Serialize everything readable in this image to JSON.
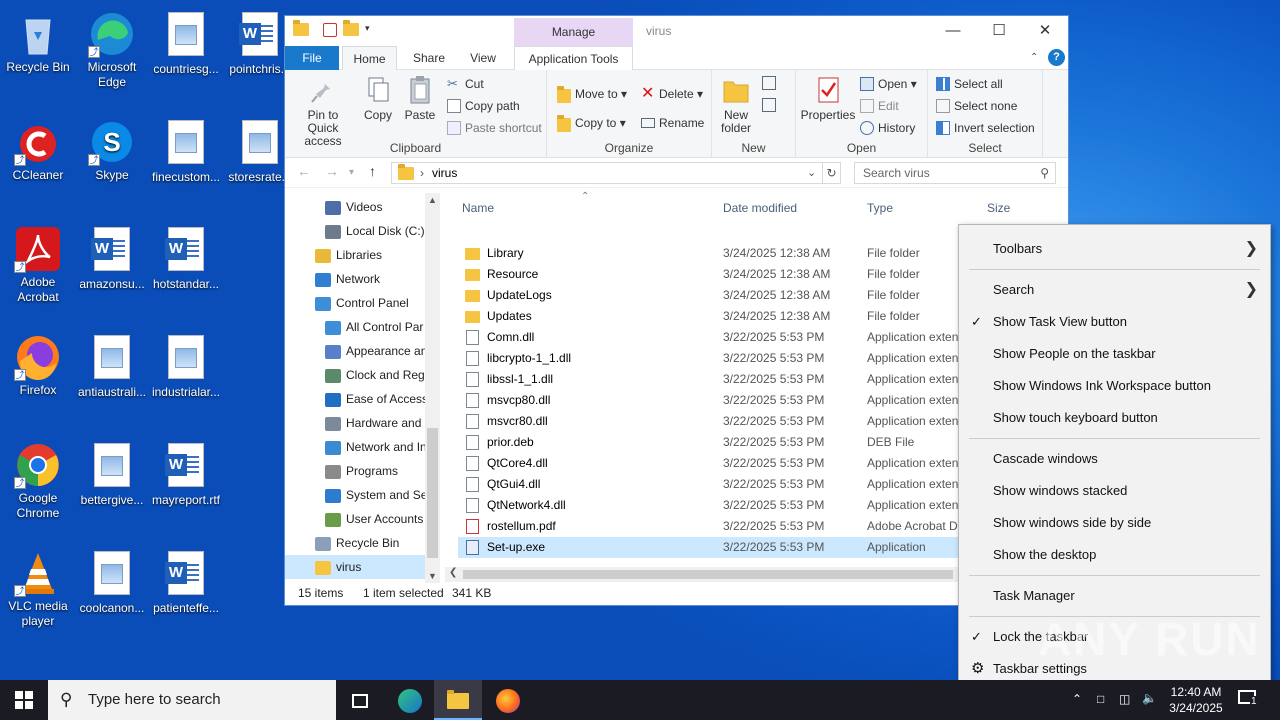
{
  "desktop": {
    "icons": [
      {
        "label": "Recycle Bin"
      },
      {
        "label": "Microsoft Edge"
      },
      {
        "label": "countriesg..."
      },
      {
        "label": "pointchris..."
      },
      {
        "label": "CCleaner"
      },
      {
        "label": "Skype"
      },
      {
        "label": "finecustom..."
      },
      {
        "label": "storesrate..."
      },
      {
        "label": "Adobe Acrobat"
      },
      {
        "label": "amazonsu..."
      },
      {
        "label": "hotstandar..."
      },
      {
        "label": "Firefox"
      },
      {
        "label": "antiaustrali..."
      },
      {
        "label": "industrialar..."
      },
      {
        "label": "Google Chrome"
      },
      {
        "label": "bettergive..."
      },
      {
        "label": "mayreport.rtf"
      },
      {
        "label": "VLC media player"
      },
      {
        "label": "coolcanon..."
      },
      {
        "label": "patienteffe..."
      }
    ]
  },
  "explorer": {
    "title": "virus",
    "manage_label": "Manage",
    "tabs": {
      "file": "File",
      "home": "Home",
      "share": "Share",
      "view": "View",
      "app_tools": "Application Tools"
    },
    "ribbon": {
      "clipboard": {
        "pin": "Pin to Quick access",
        "copy": "Copy",
        "paste": "Paste",
        "cut": "Cut",
        "copy_path": "Copy path",
        "paste_shortcut": "Paste shortcut",
        "label": "Clipboard"
      },
      "organize": {
        "move_to": "Move to ▾",
        "copy_to": "Copy to ▾",
        "delete": "Delete ▾",
        "rename": "Rename",
        "label": "Organize"
      },
      "new": {
        "new_folder": "New folder",
        "label": "New"
      },
      "open": {
        "properties": "Properties",
        "open": "Open ▾",
        "edit": "Edit",
        "history": "History",
        "label": "Open"
      },
      "select": {
        "select_all": "Select all",
        "select_none": "Select none",
        "invert": "Invert selection",
        "label": "Select"
      }
    },
    "address": {
      "path": "virus",
      "search_placeholder": "Search virus"
    },
    "nav": [
      {
        "label": "Videos",
        "color": "#4f6ea8"
      },
      {
        "label": "Local Disk (C:)",
        "color": "#6d7b8c"
      },
      {
        "label": "Libraries",
        "color": "#e8b93a"
      },
      {
        "label": "Network",
        "color": "#2f7fd3"
      },
      {
        "label": "Control Panel",
        "color": "#3c8ed8"
      },
      {
        "label": "All Control Par",
        "color": "#3c8ed8"
      },
      {
        "label": "Appearance an",
        "color": "#5a7fc9"
      },
      {
        "label": "Clock and Regi",
        "color": "#5a8a6a"
      },
      {
        "label": "Ease of Access",
        "color": "#1f6fc5"
      },
      {
        "label": "Hardware and",
        "color": "#7d8a99"
      },
      {
        "label": "Network and In",
        "color": "#3b8ad4"
      },
      {
        "label": "Programs",
        "color": "#8a8a8a"
      },
      {
        "label": "System and Se",
        "color": "#2e7bd0"
      },
      {
        "label": "User Accounts",
        "color": "#6b9c4a"
      },
      {
        "label": "Recycle Bin",
        "color": "#8aa0b8"
      },
      {
        "label": "virus",
        "color": "#f5c542"
      }
    ],
    "columns": {
      "name": "Name",
      "date": "Date modified",
      "type": "Type",
      "size": "Size"
    },
    "files": [
      {
        "name": "Library",
        "date": "3/24/2025 12:38 AM",
        "type": "File folder",
        "kind": "fd"
      },
      {
        "name": "Resource",
        "date": "3/24/2025 12:38 AM",
        "type": "File folder",
        "kind": "fd"
      },
      {
        "name": "UpdateLogs",
        "date": "3/24/2025 12:38 AM",
        "type": "File folder",
        "kind": "fd"
      },
      {
        "name": "Updates",
        "date": "3/24/2025 12:38 AM",
        "type": "File folder",
        "kind": "fd"
      },
      {
        "name": "Comn.dll",
        "date": "3/22/2025 5:53 PM",
        "type": "Application exten",
        "kind": "dl"
      },
      {
        "name": "libcrypto-1_1.dll",
        "date": "3/22/2025 5:53 PM",
        "type": "Application exten",
        "kind": "dl"
      },
      {
        "name": "libssl-1_1.dll",
        "date": "3/22/2025 5:53 PM",
        "type": "Application exten",
        "kind": "dl"
      },
      {
        "name": "msvcp80.dll",
        "date": "3/22/2025 5:53 PM",
        "type": "Application exten",
        "kind": "dl"
      },
      {
        "name": "msvcr80.dll",
        "date": "3/22/2025 5:53 PM",
        "type": "Application exten",
        "kind": "dl"
      },
      {
        "name": "prior.deb",
        "date": "3/22/2025 5:53 PM",
        "type": "DEB File",
        "kind": "dl"
      },
      {
        "name": "QtCore4.dll",
        "date": "3/22/2025 5:53 PM",
        "type": "Application exten",
        "kind": "dl"
      },
      {
        "name": "QtGui4.dll",
        "date": "3/22/2025 5:53 PM",
        "type": "Application exten",
        "kind": "dl"
      },
      {
        "name": "QtNetwork4.dll",
        "date": "3/22/2025 5:53 PM",
        "type": "Application exten",
        "kind": "dl"
      },
      {
        "name": "rostellum.pdf",
        "date": "3/22/2025 5:53 PM",
        "type": "Adobe Acrobat D",
        "kind": "pdf"
      },
      {
        "name": "Set-up.exe",
        "date": "3/22/2025 5:53 PM",
        "type": "Application",
        "kind": "exe"
      }
    ],
    "status": {
      "items": "15 items",
      "selected": "1 item selected",
      "size": "341 KB"
    }
  },
  "context_menu": {
    "toolbars": "Toolbars",
    "search": "Search",
    "task_view": "Show Task View button",
    "people": "Show People on the taskbar",
    "ink": "Show Windows Ink Workspace button",
    "touch_kb": "Show touch keyboard button",
    "cascade": "Cascade windows",
    "stacked": "Show windows stacked",
    "side_by_side": "Show windows side by side",
    "desktop": "Show the desktop",
    "task_manager": "Task Manager",
    "lock": "Lock the taskbar",
    "settings": "Taskbar settings"
  },
  "watermark": "ANY RUN",
  "taskbar": {
    "search_placeholder": "Type here to search",
    "time": "12:40 AM",
    "date": "3/24/2025",
    "notif_count": "1"
  }
}
